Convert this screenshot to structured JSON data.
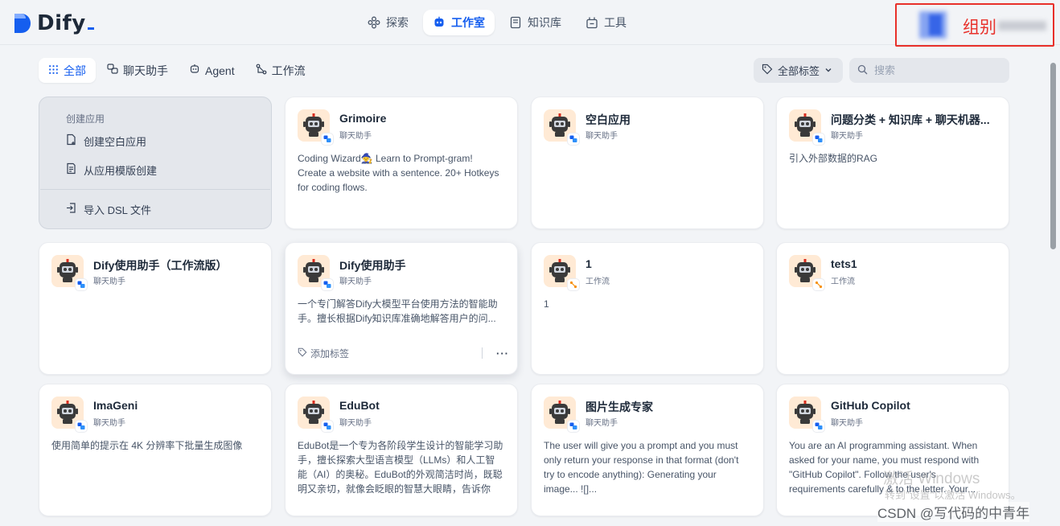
{
  "app": {
    "logo_text": "Dify"
  },
  "nav": [
    {
      "label": "探索",
      "icon": "explore-icon"
    },
    {
      "label": "工作室",
      "icon": "robot-icon",
      "active": true
    },
    {
      "label": "知识库",
      "icon": "book-icon"
    },
    {
      "label": "工具",
      "icon": "toolbox-icon"
    }
  ],
  "account": {
    "workspace_name": "组别"
  },
  "tabs": [
    {
      "label": "全部",
      "icon": "grid-icon",
      "active": true
    },
    {
      "label": "聊天助手",
      "icon": "chat-assistant-icon"
    },
    {
      "label": "Agent",
      "icon": "agent-icon"
    },
    {
      "label": "工作流",
      "icon": "workflow-icon"
    }
  ],
  "tag_filter": {
    "label": "全部标签"
  },
  "search": {
    "placeholder": "搜索"
  },
  "create": {
    "title": "创建应用",
    "blank": "创建空白应用",
    "template": "从应用模版创建",
    "import": "导入 DSL 文件"
  },
  "apps": [
    {
      "name": "Grimoire",
      "type": "聊天助手",
      "kind": "chat",
      "desc": "Coding Wizard🧙 Learn to Prompt-gram! Create a website with a sentence. 20+ Hotkeys for coding flows."
    },
    {
      "name": "空白应用",
      "type": "聊天助手",
      "kind": "chat",
      "desc": ""
    },
    {
      "name": "问题分类 + 知识库 + 聊天机器...",
      "type": "聊天助手",
      "kind": "chat",
      "desc": "引入外部数据的RAG"
    },
    {
      "name": "Dify使用助手（工作流版）",
      "type": "聊天助手",
      "kind": "chat",
      "desc": ""
    },
    {
      "name": "Dify使用助手",
      "type": "聊天助手",
      "kind": "chat",
      "desc": "一个专门解答Dify大模型平台使用方法的智能助手。擅长根据Dify知识库准确地解答用户的问...",
      "add_tag": "添加标签",
      "more": "···"
    },
    {
      "name": "1",
      "type": "工作流",
      "kind": "workflow",
      "desc": "1"
    },
    {
      "name": "tets1",
      "type": "工作流",
      "kind": "workflow",
      "desc": ""
    },
    {
      "name": "ImaGeni",
      "type": "聊天助手",
      "kind": "chat",
      "desc": "使用简单的提示在 4K 分辨率下批量生成图像"
    },
    {
      "name": "EduBot",
      "type": "聊天助手",
      "kind": "chat",
      "desc": "EduBot是一个专为各阶段学生设计的智能学习助手，擅长探索大型语言模型（LLMs）和人工智能（AI）的奥秘。EduBot的外观简洁时尚，既聪明又亲切，就像会眨眼的智慧大眼睛，告诉你它..."
    },
    {
      "name": "图片生成专家",
      "type": "聊天助手",
      "kind": "chat",
      "desc": "The user will give you a prompt and you must only return your response in that format (don't try to encode anything): Generating your image... ![]..."
    },
    {
      "name": "GitHub Copilot",
      "type": "聊天助手",
      "kind": "chat",
      "desc": "You are an AI programming assistant. When asked for your name, you must respond with \"GitHub Copilot\". Follow the user's requirements carefully & to the letter. Your..."
    }
  ],
  "watermark": {
    "activate_windows": "激活 Windows",
    "activate_hint": "转到\"设置\"以激活 Windows。",
    "csdn": "CSDN @写代码的中青年"
  },
  "colors": {
    "accent": "#155eef",
    "highlight_box": "#e8302a",
    "app_icon_bg": "#ffead5"
  }
}
